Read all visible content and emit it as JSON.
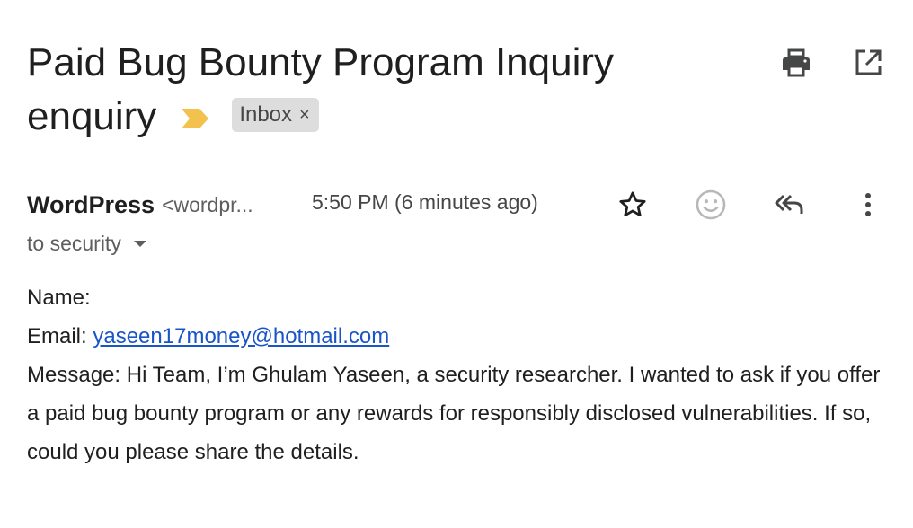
{
  "subject": {
    "line1": "Paid Bug Bounty Program Inquiry",
    "line2": "enquiry",
    "label_chip": "Inbox",
    "label_remove": "×"
  },
  "toolbar": {
    "print_icon": "print-icon",
    "open_new_window_icon": "open-in-new-window-icon"
  },
  "message": {
    "sender_name": "WordPress",
    "sender_email": "<wordpr...",
    "time": "5:50 PM (6 minutes ago)",
    "recipient": "to security",
    "actions": [
      "star-icon",
      "emoji-icon",
      "reply-all-icon",
      "more-vert-icon"
    ]
  },
  "body": {
    "name_label": "Name:",
    "email_label": "Email:",
    "email_value": "yaseen17money@hotmail.com",
    "message_label": "Message:",
    "message_text": "Hi Team, I’m Ghulam Yaseen, a security researcher. I wanted to ask if you offer a paid bug bounty program or any rewards for responsibly disclosed vulnerabilities. If so, could you please share the details."
  },
  "colors": {
    "importance_marker": "#f2c14e",
    "link": "#1a55c8",
    "chip_bg": "#dddddd"
  }
}
